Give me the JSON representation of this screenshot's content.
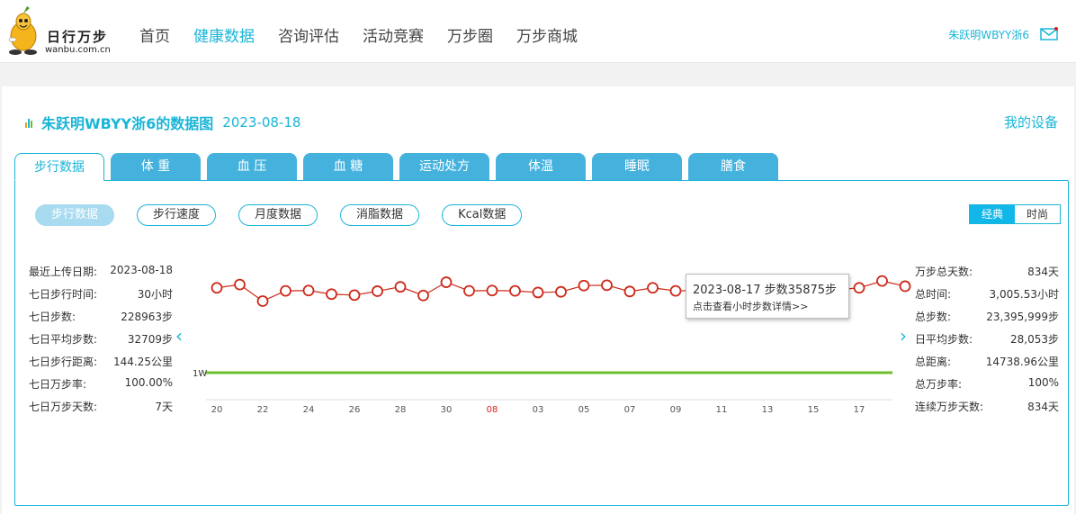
{
  "brand": {
    "name": "日行万步",
    "url": "wanbu.com.cn"
  },
  "nav": [
    {
      "label": "首页",
      "active": false
    },
    {
      "label": "健康数据",
      "active": true
    },
    {
      "label": "咨询评估",
      "active": false
    },
    {
      "label": "活动竞赛",
      "active": false
    },
    {
      "label": "万步圈",
      "active": false
    },
    {
      "label": "万步商城",
      "active": false
    }
  ],
  "user": {
    "name": "朱跃明WBYY浙6"
  },
  "header": {
    "title": "朱跃明WBYY浙6的数据图",
    "date": "2023-08-18",
    "device_link": "我的设备"
  },
  "tabs": [
    "步行数据",
    "体 重",
    "血 压",
    "血 糖",
    "运动处方",
    "体温",
    "睡眠",
    "膳食"
  ],
  "subtabs": [
    "步行数据",
    "步行速度",
    "月度数据",
    "消脂数据",
    "Kcal数据"
  ],
  "modes": [
    "经典",
    "时尚"
  ],
  "stats_left": [
    {
      "label": "最近上传日期:",
      "value": "2023-08-18"
    },
    {
      "label": "七日步行时间:",
      "value": "30小时"
    },
    {
      "label": "七日步数:",
      "value": "228963步"
    },
    {
      "label": "七日平均步数:",
      "value": "32709步"
    },
    {
      "label": "七日步行距离:",
      "value": "144.25公里"
    },
    {
      "label": "七日万步率:",
      "value": "100.00%"
    },
    {
      "label": "七日万步天数:",
      "value": "7天"
    }
  ],
  "stats_right": [
    {
      "label": "万步总天数:",
      "value": "834天"
    },
    {
      "label": "总时间:",
      "value": "3,005.53小时"
    },
    {
      "label": "总步数:",
      "value": "23,395,999步"
    },
    {
      "label": "日平均步数:",
      "value": "28,053步"
    },
    {
      "label": "总距离:",
      "value": "14738.96公里"
    },
    {
      "label": "总万步率:",
      "value": "100%"
    },
    {
      "label": "连续万步天数:",
      "value": "834天"
    }
  ],
  "tooltip": {
    "title": "2023-08-17 步数35875步",
    "hint": "点击查看小时步数详情>>"
  },
  "colors": {
    "accent": "#1ab5d8",
    "tab": "#45b2de",
    "line": "#cc2a1a",
    "threshold": "#6cbf2e",
    "month_tick": "#e02020"
  },
  "chart_data": {
    "type": "line",
    "threshold_label": "1W",
    "x_tick_labels": [
      "20",
      "22",
      "24",
      "26",
      "28",
      "30",
      "08",
      "03",
      "05",
      "07",
      "09",
      "11",
      "13",
      "15",
      "17"
    ],
    "highlight_tick": "08",
    "series": [
      {
        "values": [
          33800,
          34800,
          29800,
          32900,
          33000,
          31900,
          31600,
          32800,
          34100,
          31500,
          35500,
          32900,
          33000,
          32900,
          32400,
          32600,
          34500,
          34600,
          32700,
          33800,
          32900,
          33000,
          33500,
          33600,
          33500,
          32800,
          32700,
          33200,
          33800,
          35875,
          34300
        ]
      }
    ]
  }
}
